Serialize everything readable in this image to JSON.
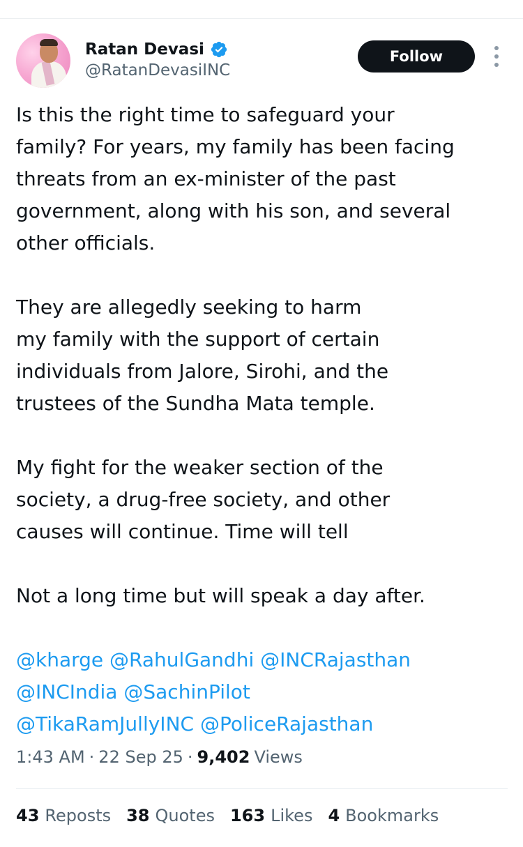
{
  "author": {
    "name": "Ratan Devasi",
    "handle": "@RatanDevasiINC",
    "verified_icon": "verified-badge-icon"
  },
  "header": {
    "follow_label": "Follow",
    "more_icon": "more-vertical-icon"
  },
  "tweet": {
    "paragraphs": [
      [
        "Is this the right time to safeguard your",
        "family? For years, my family has been facing",
        "threats from an ex-minister of the past",
        "government, along with his son, and several",
        "other officials."
      ],
      [
        "They are allegedly seeking to harm",
        "my family with the support of certain",
        "individuals from Jalore, Sirohi, and the",
        "trustees of the Sundha Mata temple."
      ],
      [
        "My fight for the weaker section of the",
        "society, a drug-free society, and other",
        "causes will continue. Time will tell"
      ],
      [
        "Not a long time but will speak a day after."
      ]
    ],
    "mentions": [
      [
        "@kharge",
        "@RahulGandhi",
        "@INCRajasthan"
      ],
      [
        "@INCIndia",
        "@SachinPilot"
      ],
      [
        "@TikaRamJullyINC",
        "@PoliceRajasthan"
      ]
    ]
  },
  "meta": {
    "time": "1:43 AM",
    "separator": "·",
    "date": "22 Sep 25",
    "views_count": "9,402",
    "views_label": "Views"
  },
  "stats": [
    {
      "count": "43",
      "label": "Reposts"
    },
    {
      "count": "38",
      "label": "Quotes"
    },
    {
      "count": "163",
      "label": "Likes"
    },
    {
      "count": "4",
      "label": "Bookmarks"
    }
  ],
  "colors": {
    "text": "#0f1419",
    "secondary": "#536471",
    "link": "#1d9bf0",
    "verified": "#1d9bf0",
    "button_bg": "#0f1419"
  }
}
